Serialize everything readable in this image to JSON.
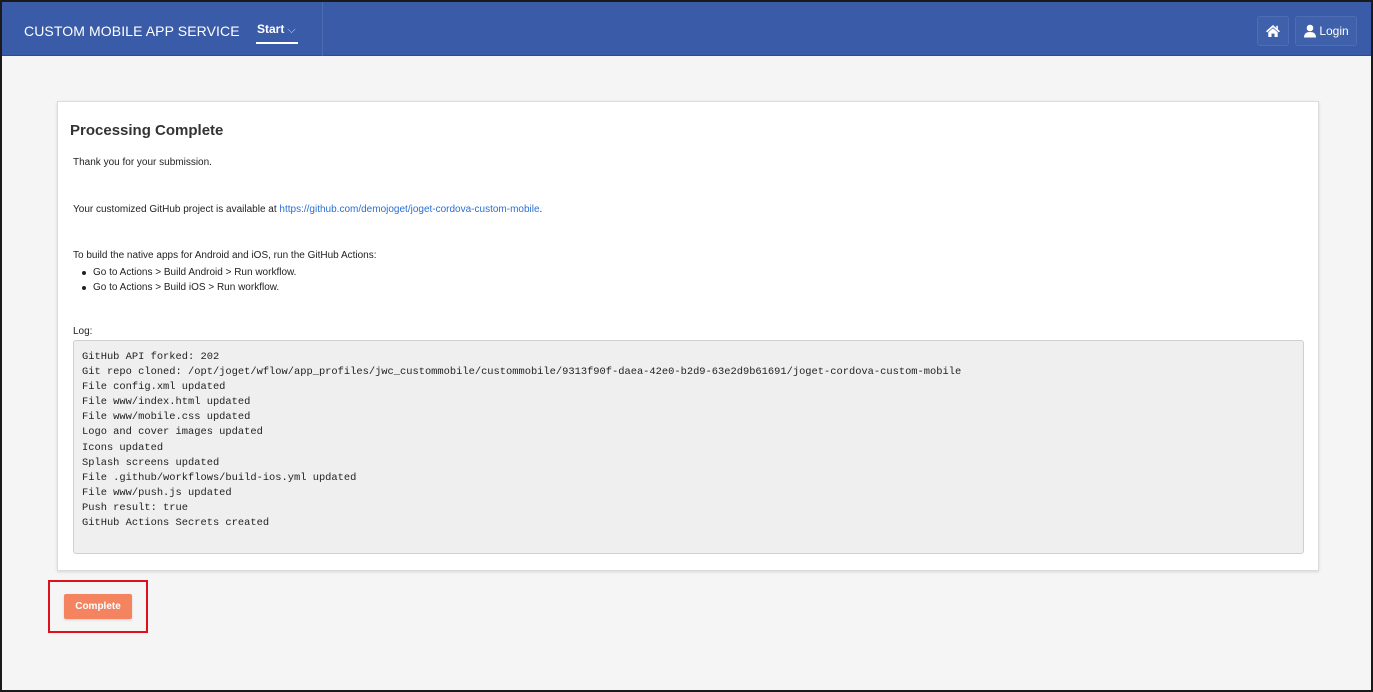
{
  "header": {
    "brand": "CUSTOM MOBILE APP SERVICE",
    "nav_start_label": "Start",
    "nav_caret": "⌵",
    "login_label": "Login",
    "home_icon": "home-icon",
    "user_icon": "user-icon",
    "bg_color": "#3a5ba7"
  },
  "main": {
    "title": "Processing Complete",
    "thanks": "Thank you for your submission.",
    "github_prefix": "Your customized GitHub project is available at ",
    "github_link": "https://github.com/demojoget/joget-cordova-custom-mobile",
    "github_suffix": ".",
    "build_intro": "To build the native apps for Android and iOS, run the GitHub Actions:",
    "build_steps": [
      "Go to Actions > Build Android > Run workflow.",
      "Go to Actions > Build iOS > Run workflow."
    ],
    "log_label": "Log:",
    "log_lines": [
      "GitHub API forked: 202",
      "Git repo cloned: /opt/joget/wflow/app_profiles/jwc_custommobile/custommobile/9313f90f-daea-42e0-b2d9-63e2d9b61691/joget-cordova-custom-mobile",
      "File config.xml updated",
      "File www/index.html updated",
      "File www/mobile.css updated",
      "Logo and cover images updated",
      "Icons updated",
      "Splash screens updated",
      "File .github/workflows/build-ios.yml updated",
      "File www/push.js updated",
      "Push result: true",
      "GitHub Actions Secrets created"
    ]
  },
  "footer": {
    "complete_label": "Complete",
    "complete_color": "#f4845f",
    "highlight_color": "#e0101a"
  }
}
